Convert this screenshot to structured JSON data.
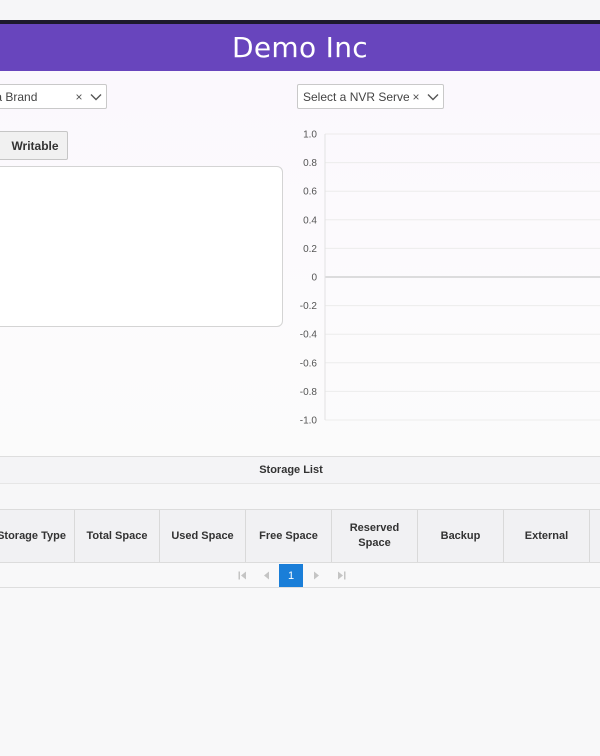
{
  "header": {
    "title": "Demo Inc"
  },
  "filters": {
    "brand_select": {
      "value": "ect a Brand",
      "clear": "×"
    },
    "nvr_select": {
      "value": "Select a NVR Server",
      "clear": "×"
    }
  },
  "buttons": {
    "writable": "Writable"
  },
  "icons": {
    "clear": "x-icon",
    "chevron": "chevron-down-icon",
    "first": "first-page-icon",
    "prev": "prev-page-icon",
    "next": "next-page-icon",
    "last": "last-page-icon"
  },
  "chart_data": {
    "type": "line",
    "series": [],
    "ylim": [
      -1.0,
      1.0
    ],
    "y_ticks": [
      "1.0",
      "0.8",
      "0.6",
      "0.4",
      "0.2",
      "0",
      "-0.2",
      "-0.4",
      "-0.6",
      "-0.8",
      "-1.0"
    ],
    "grid": true,
    "title": "",
    "xlabel": "",
    "ylabel": ""
  },
  "storage": {
    "title": "Storage List",
    "columns": [
      "Storage Type",
      "Total Space",
      "Used Space",
      "Free Space",
      "Reserved Space",
      "Backup",
      "External"
    ],
    "rows": []
  },
  "pagination": {
    "current_page": "1"
  },
  "colors": {
    "header_bg": "#6845bd",
    "accent_page": "#1a7ed8"
  }
}
